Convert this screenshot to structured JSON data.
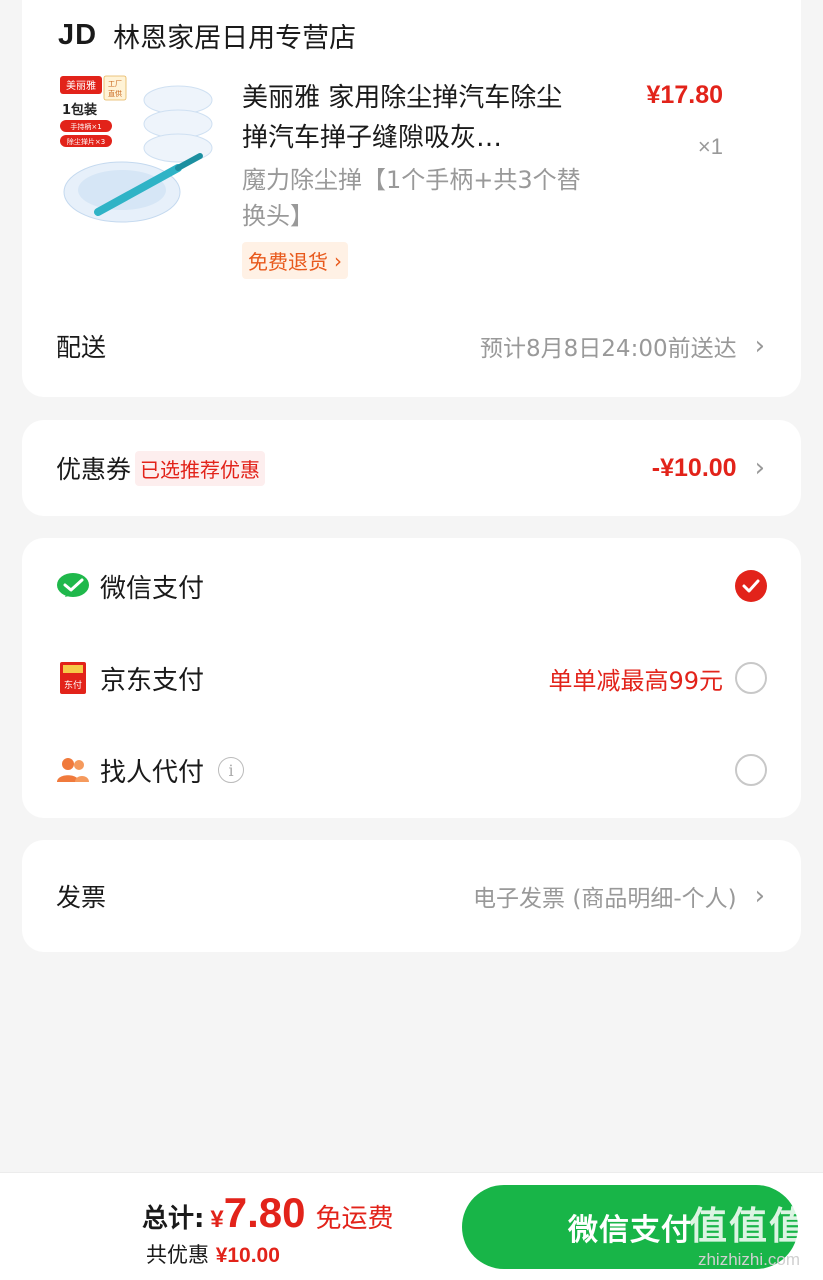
{
  "store": {
    "logo": "JD",
    "name": "林恩家居日用专营店"
  },
  "product": {
    "image_brand": "美丽雅",
    "image_tag": "工厂直供",
    "image_pack": "1包装",
    "image_line1": "手持柄×1",
    "image_line2": "除尘掸片×3",
    "title": "美丽雅 家用除尘掸汽车除尘掸汽车掸子缝隙吸灰…",
    "spec": "魔力除尘掸【1个手柄+共3个替换头】",
    "return_badge": "免费退货",
    "price": "¥17.80",
    "quantity": "×1"
  },
  "delivery": {
    "label": "配送",
    "value": "预计8月8日24:00前送达"
  },
  "coupon": {
    "label": "优惠券",
    "tag": "已选推荐优惠",
    "value": "-¥10.00"
  },
  "payment": {
    "options": [
      {
        "label": "微信支付",
        "promo": "",
        "checked": true
      },
      {
        "label": "京东支付",
        "promo": "单单减最高99元",
        "checked": false
      },
      {
        "label": "找人代付",
        "promo": "",
        "checked": false
      }
    ],
    "jd_icon_text": "东付",
    "info_glyph": "i"
  },
  "invoice": {
    "label": "发票",
    "value": "电子发票 (商品明细-个人)"
  },
  "bottom": {
    "total_label": "总计:",
    "currency": "¥",
    "total_amount": "7.80",
    "free_shipping": "免运费",
    "discount_label": "共优惠",
    "discount_amount": "¥10.00",
    "pay_button": "微信支付"
  },
  "watermark": {
    "big": "值值值",
    "small": "zhizhizhi.com"
  },
  "colors": {
    "brand_red": "#e2231a",
    "wechat_green": "#18b548",
    "background": "#f5f5f5"
  }
}
